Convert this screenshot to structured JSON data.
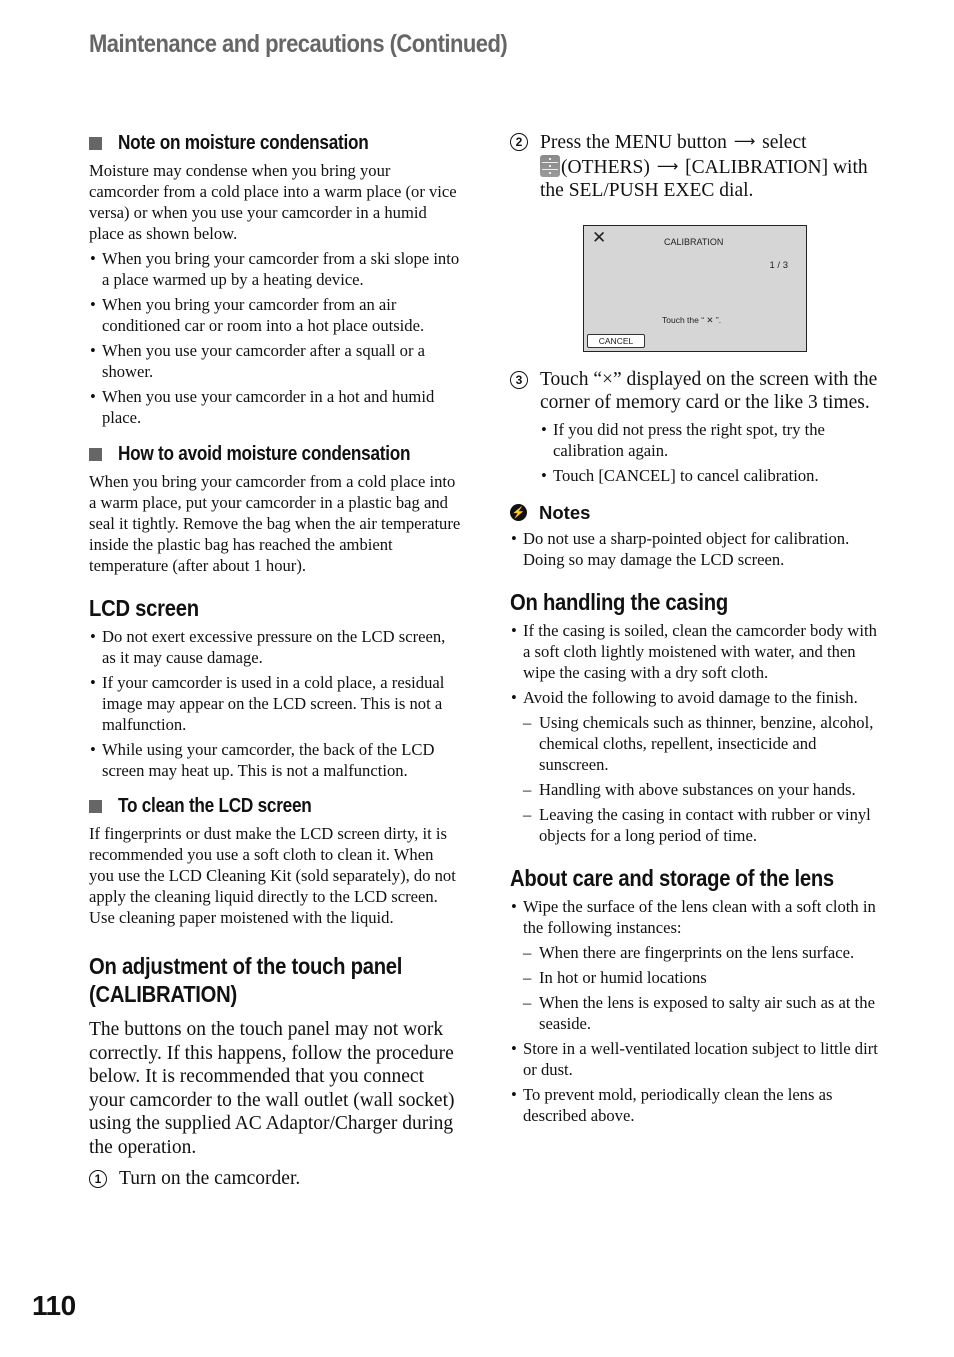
{
  "header": {
    "running_title": "Maintenance and precautions (Continued)"
  },
  "left": {
    "moisture_note": {
      "heading": "Note on moisture condensation",
      "intro": "Moisture may condense when you bring your camcorder from a cold place into a warm place (or vice versa) or when you use your camcorder in a humid place as shown below.",
      "bullets": [
        "When you bring your camcorder from a ski slope into a place warmed up by a heating device.",
        "When you bring your camcorder from an air conditioned car or room into a hot place outside.",
        "When you use your camcorder after a squall or a shower.",
        "When you use your camcorder in a hot and humid place."
      ]
    },
    "avoid_moisture": {
      "heading": "How to avoid moisture condensation",
      "text": "When you bring your camcorder from a cold place into a warm place, put your camcorder in a plastic bag and seal it tightly. Remove the bag when the air temperature inside the plastic bag has reached the ambient temperature (after about 1 hour)."
    },
    "lcd_screen": {
      "heading": "LCD screen",
      "bullets": [
        "Do not exert excessive pressure on the LCD screen, as it may cause damage.",
        "If your camcorder is used in a cold place, a residual image may appear on the LCD screen. This is not a malfunction.",
        "While using your camcorder, the back of the LCD screen may heat up. This is not a malfunction."
      ]
    },
    "clean_lcd": {
      "heading": "To clean the LCD screen",
      "text": "If fingerprints or dust make the LCD screen dirty, it is recommended you use a soft cloth to clean it. When you use the LCD Cleaning Kit (sold separately), do not apply the cleaning liquid directly to the LCD screen. Use cleaning paper moistened with the liquid."
    },
    "calibration": {
      "heading_line1": "On adjustment of the touch panel",
      "heading_line2": "(CALIBRATION)",
      "text": "The buttons on the touch panel may not work correctly. If this happens, follow the procedure below. It is recommended that you connect your camcorder to the wall outlet (wall socket) using the supplied AC Adaptor/Charger during the operation.",
      "step1_num": "1",
      "step1": "Turn on the camcorder."
    }
  },
  "right": {
    "step2": {
      "num": "2",
      "part1": "Press the MENU button",
      "part2": "select",
      "part3": "(OTHERS)",
      "part4": "[CALIBRATION] with the SEL/PUSH EXEC dial.",
      "arrow": "⟶",
      "icon": "others-menu-icon"
    },
    "lcd_illustration": {
      "close_symbol": "✕",
      "title": "CALIBRATION",
      "page": "1 / 3",
      "instruction": "Touch the “ ✕ ”.",
      "cancel_label": "CANCEL"
    },
    "step3": {
      "num": "3",
      "text": "Touch “×” displayed on the screen with the corner of memory card or the like 3 times.",
      "bullets": [
        "If you did not press the right spot, try the calibration again.",
        "Touch [CANCEL] to cancel calibration."
      ]
    },
    "notes": {
      "heading": "Notes",
      "icon": "notes-icon",
      "bullets": [
        "Do not use a sharp-pointed object for calibration. Doing so may damage the LCD screen."
      ]
    },
    "casing": {
      "heading": "On handling the casing",
      "bullet1": "If the casing is soiled, clean the camcorder body with a soft cloth lightly moistened with water, and then wipe the casing with a dry soft cloth.",
      "bullet2": "Avoid the following to avoid damage to the finish.",
      "dashes": [
        "Using chemicals such as thinner, benzine, alcohol, chemical cloths, repellent, insecticide and sunscreen.",
        "Handling with above substances on your hands.",
        "Leaving the casing in contact with rubber or vinyl objects for a long period of time."
      ]
    },
    "lens": {
      "heading": "About care and storage of the lens",
      "bullet1": "Wipe the surface of the lens clean with a soft cloth in the following instances:",
      "dashes": [
        "When there are fingerprints on the lens surface.",
        "In hot or humid locations",
        "When the lens is exposed to salty air such as at the seaside."
      ],
      "bullet2": "Store in a well-ventilated location subject to little dirt or dust.",
      "bullet3": "To prevent mold, periodically clean the lens as described above."
    }
  },
  "footer": {
    "page_number": "110"
  }
}
